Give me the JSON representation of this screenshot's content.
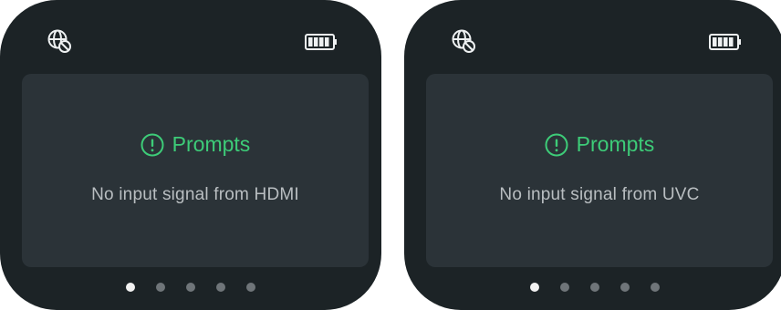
{
  "screens": [
    {
      "prompt_title": "Prompts",
      "message": "No input signal from HDMI",
      "page_indicator": {
        "total": 5,
        "active_index": 0
      }
    },
    {
      "prompt_title": "Prompts",
      "message": "No input signal from UVC",
      "page_indicator": {
        "total": 5,
        "active_index": 0
      }
    }
  ],
  "colors": {
    "background": "#1c2326",
    "card": "#2b3338",
    "accent": "#3dcc78",
    "message_text": "#b9bec1",
    "dot_active": "#f2f2f2",
    "dot_inactive": "#6f7579"
  },
  "icons": {
    "status_left": "network-disabled-icon",
    "status_right": "battery-full-icon",
    "prompt": "alert-circle-icon"
  }
}
